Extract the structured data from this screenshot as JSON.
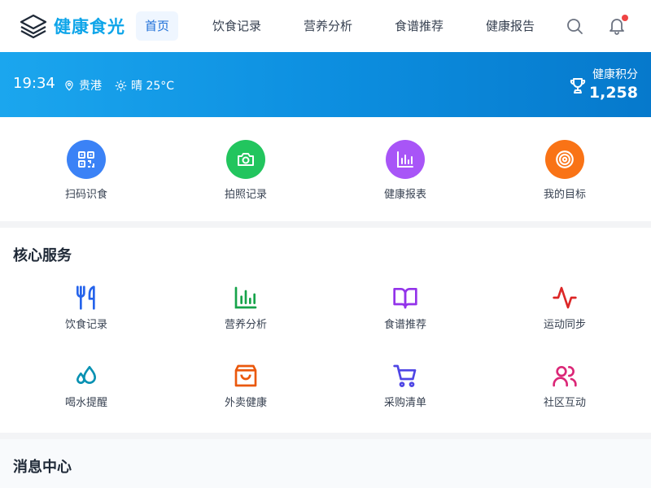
{
  "app": {
    "name": "健康食光"
  },
  "nav": {
    "items": [
      {
        "label": "首页",
        "active": true
      },
      {
        "label": "饮食记录"
      },
      {
        "label": "营养分析"
      },
      {
        "label": "食谱推荐"
      },
      {
        "label": "健康报告"
      }
    ],
    "icons": [
      "search-icon",
      "bell-icon"
    ],
    "notification_dot_color": "#ef4444"
  },
  "banner": {
    "time": "19:34",
    "location": "贵港",
    "weather": "晴 25°C",
    "points_label": "健康积分",
    "points_value": "1,258"
  },
  "quick_actions": [
    {
      "label": "扫码识食",
      "icon": "qr-scan-icon",
      "color": "#3b82f6"
    },
    {
      "label": "拍照记录",
      "icon": "camera-icon",
      "color": "#22c55e"
    },
    {
      "label": "健康报表",
      "icon": "bar-chart-icon",
      "color": "#a855f7"
    },
    {
      "label": "我的目标",
      "icon": "target-icon",
      "color": "#f97316"
    }
  ],
  "core_services": {
    "title": "核心服务",
    "items": [
      {
        "label": "饮食记录",
        "icon": "utensils-icon",
        "color": "#2563eb"
      },
      {
        "label": "营养分析",
        "icon": "bar-chart-icon",
        "color": "#16a34a"
      },
      {
        "label": "食谱推荐",
        "icon": "book-icon",
        "color": "#9333ea"
      },
      {
        "label": "运动同步",
        "icon": "activity-icon",
        "color": "#dc2626"
      },
      {
        "label": "喝水提醒",
        "icon": "droplets-icon",
        "color": "#0891b2"
      },
      {
        "label": "外卖健康",
        "icon": "shopping-bag-icon",
        "color": "#ea580c"
      },
      {
        "label": "采购清单",
        "icon": "cart-icon",
        "color": "#4f46e5"
      },
      {
        "label": "社区互动",
        "icon": "users-icon",
        "color": "#db2777"
      }
    ]
  },
  "message_center": {
    "title": "消息中心"
  }
}
